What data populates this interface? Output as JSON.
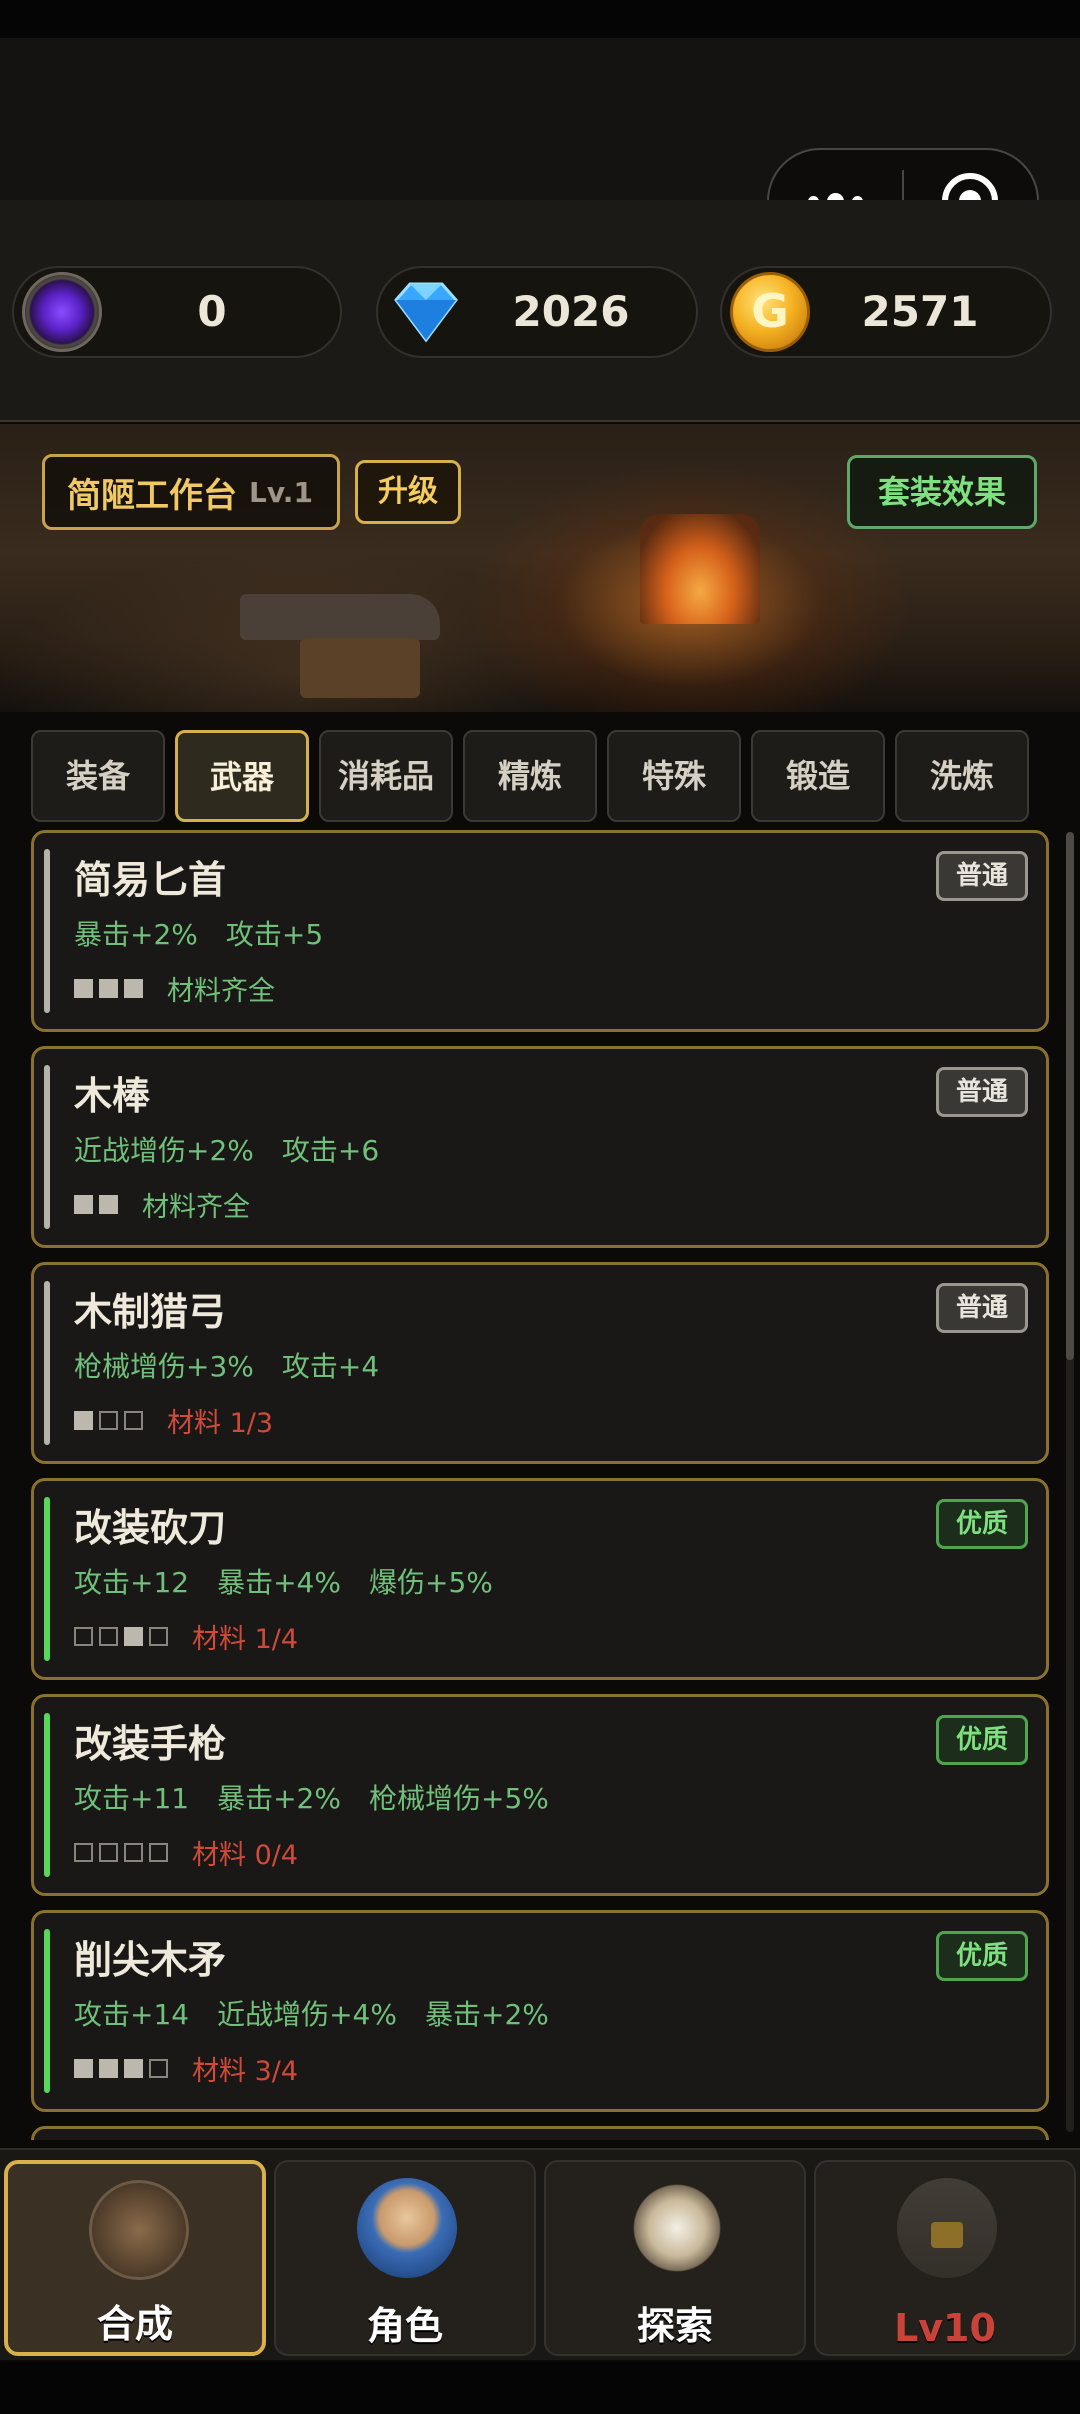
{
  "currency": {
    "crystal": "0",
    "diamond": "2026",
    "gold": "2571",
    "gold_symbol": "G"
  },
  "workbench": {
    "name": "简陋工作台",
    "level": "Lv.1",
    "upgrade_label": "升级",
    "set_effect_label": "套装效果"
  },
  "tabs": [
    "装备",
    "武器",
    "消耗品",
    "精炼",
    "特殊",
    "锻造",
    "洗炼"
  ],
  "active_tab": "武器",
  "items": [
    {
      "name": "简易匕首",
      "rarity": "普通",
      "stats": [
        "暴击+2%",
        "攻击+5"
      ],
      "materials_text": "材料齐全",
      "materials_have": 3,
      "materials_need": 3,
      "complete": true
    },
    {
      "name": "木棒",
      "rarity": "普通",
      "stats": [
        "近战增伤+2%",
        "攻击+6"
      ],
      "materials_text": "材料齐全",
      "materials_have": 2,
      "materials_need": 2,
      "complete": true
    },
    {
      "name": "木制猎弓",
      "rarity": "普通",
      "stats": [
        "枪械增伤+3%",
        "攻击+4"
      ],
      "materials_text": "材料 1/3",
      "materials_have": 1,
      "materials_need": 3,
      "complete": false
    },
    {
      "name": "改装砍刀",
      "rarity": "优质",
      "stats": [
        "攻击+12",
        "暴击+4%",
        "爆伤+5%"
      ],
      "materials_text": "材料 1/4",
      "materials_have": 1,
      "materials_need": 4,
      "complete": false
    },
    {
      "name": "改装手枪",
      "rarity": "优质",
      "stats": [
        "攻击+11",
        "暴击+2%",
        "枪械增伤+5%"
      ],
      "materials_text": "材料 0/4",
      "materials_have": 0,
      "materials_need": 4,
      "complete": false
    },
    {
      "name": "削尖木矛",
      "rarity": "优质",
      "stats": [
        "攻击+14",
        "近战增伤+4%",
        "暴击+2%"
      ],
      "materials_text": "材料 3/4",
      "materials_have": 3,
      "materials_need": 4,
      "complete": false
    }
  ],
  "nav": [
    {
      "label": "合成",
      "icon": "crafting-icon",
      "active": true,
      "locked": false
    },
    {
      "label": "角色",
      "icon": "character-icon",
      "active": false,
      "locked": false
    },
    {
      "label": "探索",
      "icon": "compass-icon",
      "active": false,
      "locked": false
    },
    {
      "label": "Lv10",
      "icon": "locked-shop-icon",
      "active": false,
      "locked": true
    }
  ],
  "colors": {
    "accent_gold": "#d6b04c",
    "common_bar": "#b8b3aa",
    "fine_bar": "#58d85a",
    "ok_text": "#6fc07a",
    "missing_text": "#d04a3a"
  }
}
